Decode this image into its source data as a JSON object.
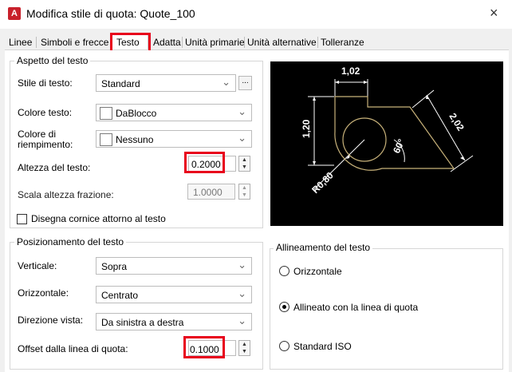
{
  "window": {
    "title": "Modifica stile di quota: Quote_100",
    "app_icon": "A",
    "close": "×"
  },
  "tabs": [
    {
      "label": "Linee",
      "active": false
    },
    {
      "label": "Simboli e frecce",
      "active": false
    },
    {
      "label": "Testo",
      "active": true
    },
    {
      "label": "Adatta",
      "active": false
    },
    {
      "label": "Unità primarie",
      "active": false
    },
    {
      "label": "Unità alternative",
      "active": false
    },
    {
      "label": "Tolleranze",
      "active": false
    }
  ],
  "aspetto": {
    "title": "Aspetto del testo",
    "stile_label": "Stile di testo:",
    "stile_value": "Standard",
    "stile_more": "...",
    "colore_label": "Colore testo:",
    "colore_value": "DaBlocco",
    "riemp_label_1": "Colore di",
    "riemp_label_2": "riempimento:",
    "riemp_value": "Nessuno",
    "altezza_label": "Altezza del testo:",
    "altezza_value": "0.2000",
    "scala_label": "Scala altezza frazione:",
    "scala_value": "1.0000",
    "cornice_label": "Disegna cornice attorno al testo",
    "cornice_checked": false
  },
  "posizionamento": {
    "title": "Posizionamento del testo",
    "verticale_label": "Verticale:",
    "verticale_value": "Sopra",
    "orizzontale_label": "Orizzontale:",
    "orizzontale_value": "Centrato",
    "direzione_label": "Direzione vista:",
    "direzione_value": "Da sinistra a destra",
    "offset_label": "Offset dalla linea di quota:",
    "offset_value": "0.1000"
  },
  "allineamento": {
    "title": "Allineamento del testo",
    "options": [
      {
        "label": "Orizzontale",
        "selected": false
      },
      {
        "label": "Allineato con la linea di quota",
        "selected": true
      },
      {
        "label": "Standard ISO",
        "selected": false
      }
    ]
  },
  "preview": {
    "dim_top": "1,02",
    "dim_left": "1,20",
    "dim_diag": "2,02",
    "dim_angle": "60°",
    "dim_radius": "R0,80"
  },
  "colors": {
    "highlight": "#e8001c",
    "preview_bg": "#000000",
    "preview_lines": "#c8b27a",
    "preview_text": "#ffffff"
  },
  "icons": {
    "chevron": "chevron-down-icon",
    "spin": "spinner-arrows-icon",
    "app": "autocad-icon",
    "close": "close-icon"
  }
}
